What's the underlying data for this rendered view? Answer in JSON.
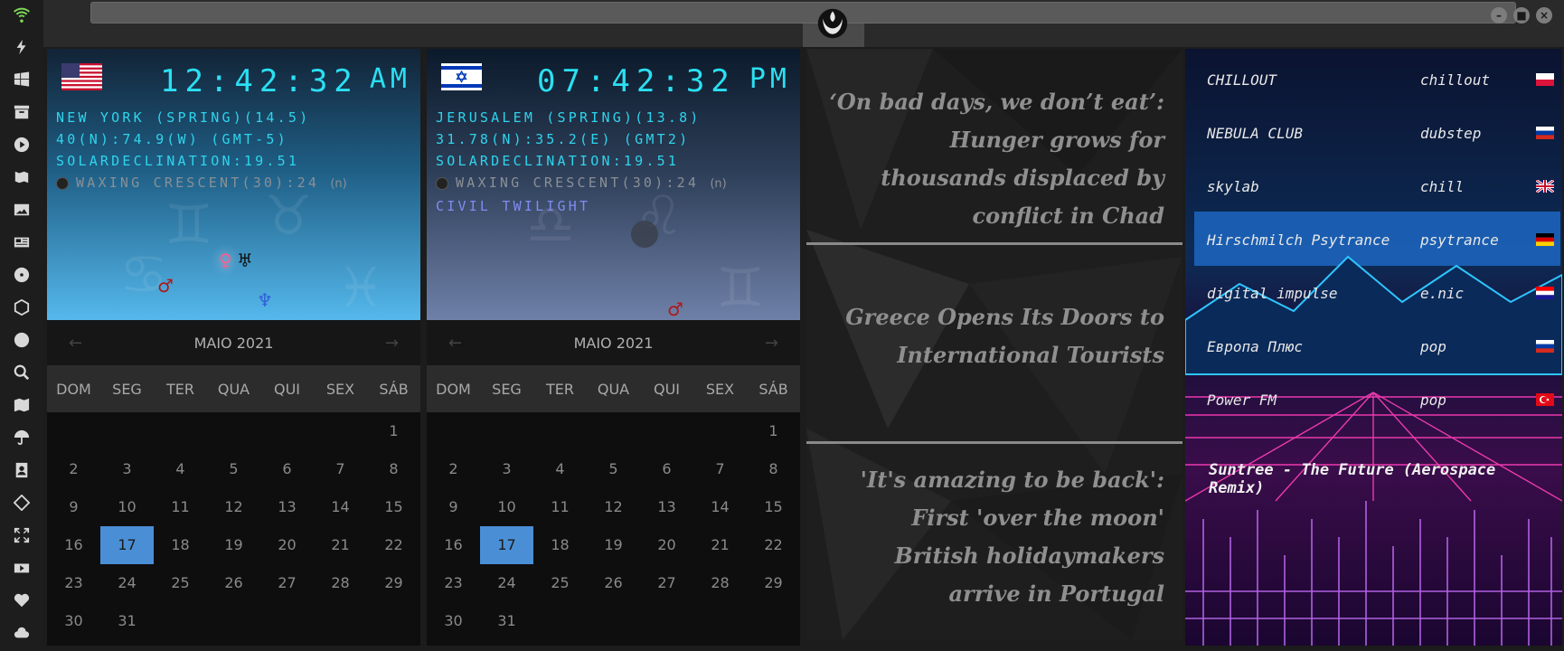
{
  "sidebar": {
    "icons": [
      "wifi-icon",
      "lightning-icon",
      "windows-icon",
      "archive-icon",
      "play-icon",
      "map-book-icon",
      "image-icon",
      "news-icon",
      "radioactive-icon",
      "hexagon-icon",
      "globe-icon",
      "search-icon",
      "map-icon",
      "umbrella-icon",
      "contact-icon",
      "tag-icon",
      "expand-icon",
      "youtube-icon",
      "heart-icon",
      "cloud-icon"
    ]
  },
  "clocks": [
    {
      "time": "12:42:32",
      "ampm": "AM",
      "city_line": "NEW YORK (SPRING)(14.5)",
      "coords_line": "40(N):74.9(W) (GMT-5)",
      "declination": "SOLARDECLINATION:19.51",
      "moon_phase": "WAXING CRESCENT(30):24",
      "moon_suffix": "(n)",
      "twilight": ""
    },
    {
      "time": "07:42:32",
      "ampm": "PM",
      "city_line": "JERUSALEM (SPRING)(13.8)",
      "coords_line": "31.78(N):35.2(E) (GMT2)",
      "declination": "SOLARDECLINATION:19.51",
      "moon_phase": "WAXING CRESCENT(30):24",
      "moon_suffix": "(n)",
      "twilight": "CIVIL TWILIGHT"
    }
  ],
  "calendar": {
    "month_label": "MAIO 2021",
    "days_of_week": [
      "DOM",
      "SEG",
      "TER",
      "QUA",
      "QUI",
      "SEX",
      "SÁB"
    ],
    "weeks": [
      [
        "",
        "",
        "",
        "",
        "",
        "",
        "1"
      ],
      [
        "2",
        "3",
        "4",
        "5",
        "6",
        "7",
        "8"
      ],
      [
        "9",
        "10",
        "11",
        "12",
        "13",
        "14",
        "15"
      ],
      [
        "16",
        "17",
        "18",
        "19",
        "20",
        "21",
        "22"
      ],
      [
        "23",
        "24",
        "25",
        "26",
        "27",
        "28",
        "29"
      ],
      [
        "30",
        "31",
        "",
        "",
        "",
        "",
        ""
      ]
    ],
    "selected_day": "17"
  },
  "news": [
    "‘On bad days, we don’t eat’: Hunger grows for thousands displaced by conflict in Chad",
    "Greece Opens Its Doors to International Tourists",
    "'It's amazing to be back': First 'over the moon' British holidaymakers arrive in Portugal"
  ],
  "radio": {
    "stations": [
      {
        "name": "CHILLOUT",
        "genre": "chillout",
        "flag": "poland"
      },
      {
        "name": "NEBULA CLUB",
        "genre": "dubstep",
        "flag": "russia"
      },
      {
        "name": "skylab",
        "genre": "chill",
        "flag": "uk"
      },
      {
        "name": "Hirschmilch Psytrance",
        "genre": "psytrance",
        "flag": "germany"
      },
      {
        "name": "digital impulse",
        "genre": "e.nic",
        "flag": "croatia"
      },
      {
        "name": "Европа Плюс",
        "genre": "pop",
        "flag": "russia"
      },
      {
        "name": "Power FM",
        "genre": "pop",
        "flag": "turkey"
      }
    ],
    "now_playing": "Suntree - The Future (Aerospace Remix)"
  },
  "colors": {
    "clock_digits": "#2be0f2",
    "selected_day": "#4a8fd6",
    "twilight_text": "#7f8cf2"
  }
}
